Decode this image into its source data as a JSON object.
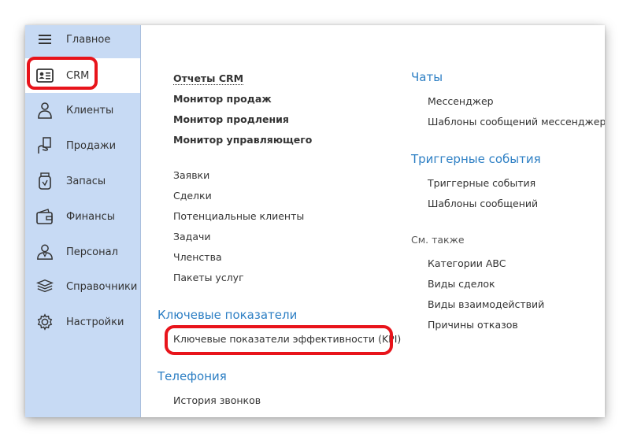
{
  "sidebar": {
    "items": [
      {
        "label": "Главное",
        "icon": "hamburger-menu-icon"
      },
      {
        "label": "CRM",
        "icon": "contact-card-icon"
      },
      {
        "label": "Клиенты",
        "icon": "client-person-icon"
      },
      {
        "label": "Продажи",
        "icon": "sales-hand-icon"
      },
      {
        "label": "Запасы",
        "icon": "stock-jar-icon"
      },
      {
        "label": "Финансы",
        "icon": "wallet-icon"
      },
      {
        "label": "Персонал",
        "icon": "staff-person-icon"
      },
      {
        "label": "Справочники",
        "icon": "books-stack-icon"
      },
      {
        "label": "Настройки",
        "icon": "gear-icon"
      }
    ]
  },
  "left_column": {
    "reports": [
      "Отчеты CRM",
      "Монитор продаж",
      "Монитор продления",
      "Монитор управляющего"
    ],
    "documents": [
      "Заявки",
      "Сделки",
      "Потенциальные клиенты",
      "Задачи",
      "Членства",
      "Пакеты услуг"
    ],
    "kpi_section": {
      "title": "Ключевые показатели",
      "items": [
        "Ключевые показатели эффективности (KPI)"
      ]
    },
    "telephony_section": {
      "title": "Телефония",
      "items": [
        "История звонков"
      ]
    }
  },
  "right_column": {
    "chats_section": {
      "title": "Чаты",
      "items": [
        "Мессенджер",
        "Шаблоны сообщений мессенджера"
      ]
    },
    "triggers_section": {
      "title": "Триггерные события",
      "items": [
        "Триггерные события",
        "Шаблоны сообщений"
      ]
    },
    "see_also": {
      "title": "См. также",
      "items": [
        "Категории ABC",
        "Виды сделок",
        "Виды взаимодействий",
        "Причины отказов"
      ]
    }
  },
  "colors": {
    "sidebar": "#c7daf4",
    "section_title": "#2d7fc4",
    "highlight": "#e8141b"
  }
}
